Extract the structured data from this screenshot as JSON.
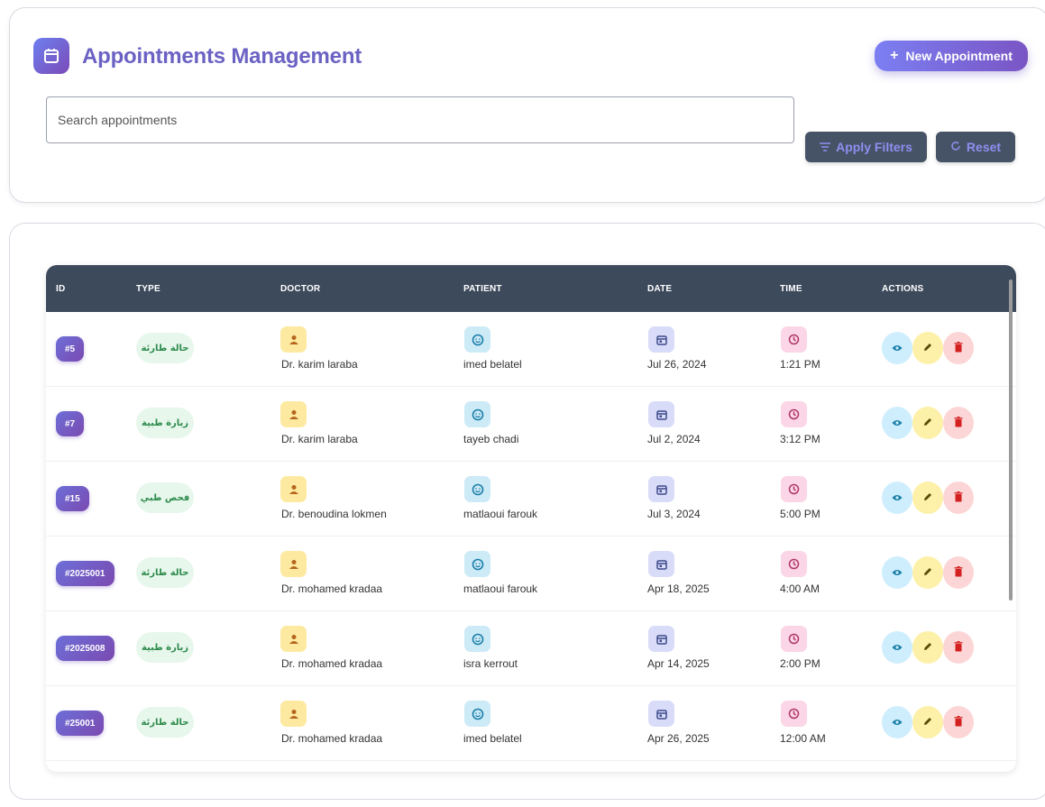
{
  "header": {
    "title": "Appointments Management",
    "new_button_label": "New Appointment",
    "search_placeholder": "Search appointments",
    "apply_label": "Apply Filters",
    "reset_label": "Reset"
  },
  "table": {
    "columns": [
      "ID",
      "TYPE",
      "DOCTOR",
      "PATIENT",
      "DATE",
      "TIME",
      "ACTIONS"
    ],
    "rows": [
      {
        "id": "#5",
        "type": "حالة طارئة",
        "doctor": "Dr. karim laraba",
        "patient": "imed belatel",
        "date": "Jul 26, 2024",
        "time": "1:21 PM"
      },
      {
        "id": "#7",
        "type": "زيارة طبية",
        "doctor": "Dr. karim laraba",
        "patient": "tayeb chadi",
        "date": "Jul 2, 2024",
        "time": "3:12 PM"
      },
      {
        "id": "#15",
        "type": "فحص طبي",
        "doctor": "Dr. benoudina lokmen",
        "patient": "matlaoui farouk",
        "date": "Jul 3, 2024",
        "time": "5:00 PM"
      },
      {
        "id": "#2025001",
        "type": "حالة طارئة",
        "doctor": "Dr. mohamed kradaa",
        "patient": "matlaoui farouk",
        "date": "Apr 18, 2025",
        "time": "4:00 AM"
      },
      {
        "id": "#2025008",
        "type": "زيارة طبية",
        "doctor": "Dr. mohamed kradaa",
        "patient": "isra kerrout",
        "date": "Apr 14, 2025",
        "time": "2:00 PM"
      },
      {
        "id": "#25001",
        "type": "حالة طارئة",
        "doctor": "Dr. mohamed kradaa",
        "patient": "imed belatel",
        "date": "Apr 26, 2025",
        "time": "12:00 AM"
      }
    ]
  },
  "colors": {
    "accent": "#6b62c4",
    "header_bg": "#3d4a5c",
    "type_badge_bg": "#e7f7ec",
    "type_badge_text": "#2c8a4a"
  },
  "icons": {
    "title": "calendar-icon",
    "new": "plus-icon",
    "apply": "filter-icon",
    "reset": "refresh-icon",
    "doctor": "person-icon",
    "patient": "face-icon",
    "date": "calendar-icon",
    "time": "clock-icon",
    "view": "eye-icon",
    "edit": "pencil-icon",
    "delete": "trash-icon"
  }
}
